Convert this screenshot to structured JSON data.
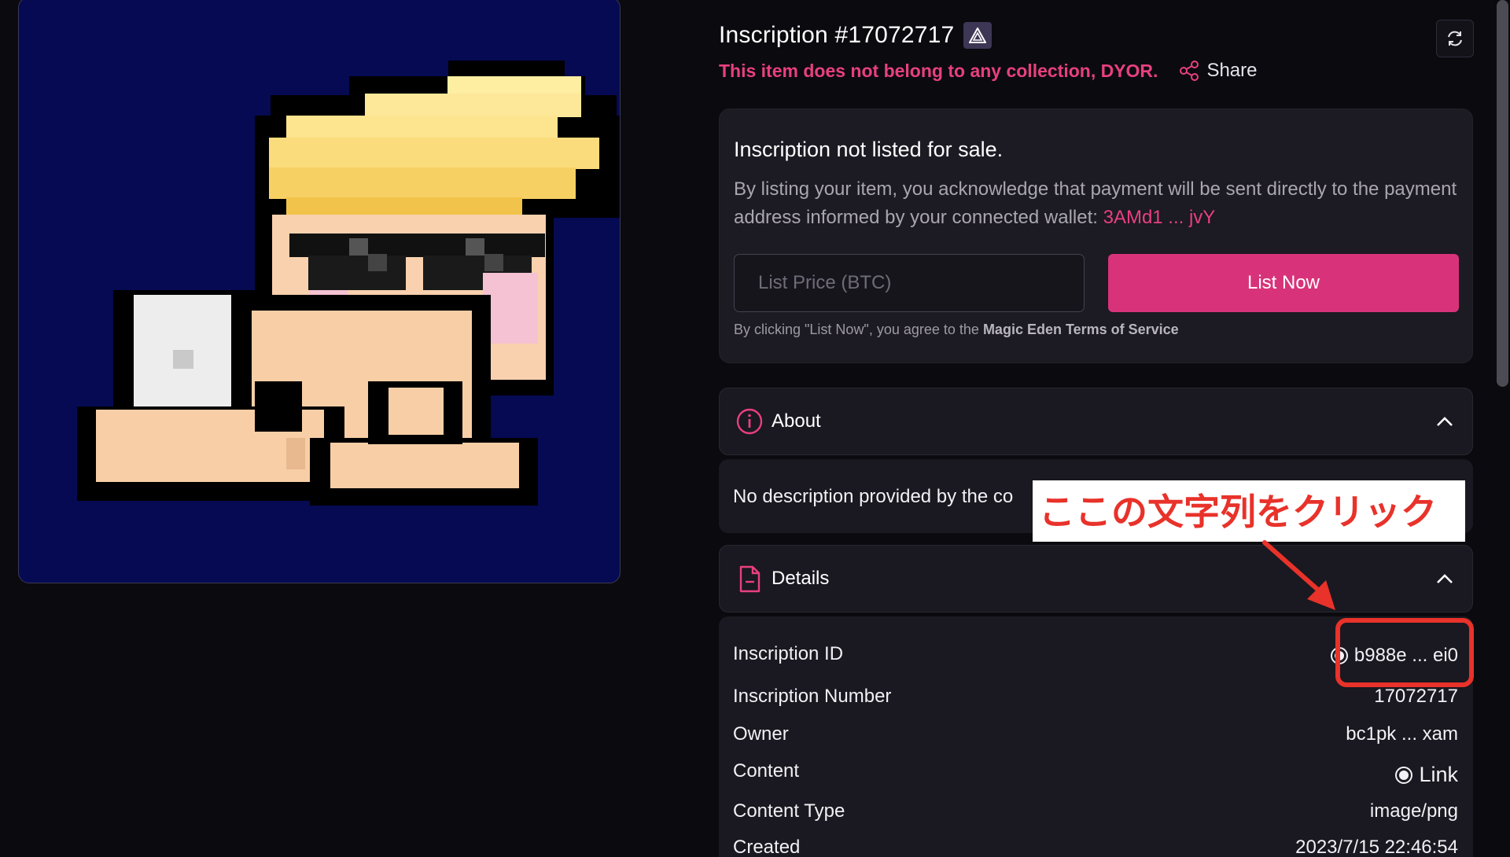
{
  "inscription": {
    "title": "Inscription #17072717",
    "warning": "This item does not belong to any collection, DYOR.",
    "share_label": "Share"
  },
  "listing": {
    "heading": "Inscription not listed for sale.",
    "description": "By listing your item, you acknowledge that payment will be sent directly to the payment address informed by your connected wallet: ",
    "wallet_address": "3AMd1 ... jvY",
    "price_placeholder": "List Price (BTC)",
    "list_button": "List Now",
    "terms_prefix": "By clicking \"List Now\", you agree to the ",
    "terms_link": "Magic Eden Terms of Service"
  },
  "about": {
    "title": "About",
    "body": "No description provided by the co"
  },
  "details": {
    "title": "Details",
    "rows": [
      {
        "key": "Inscription ID",
        "value": "b988e ... ei0"
      },
      {
        "key": "Inscription Number",
        "value": "17072717"
      },
      {
        "key": "Owner",
        "value": "bc1pk ... xam"
      },
      {
        "key": "Content",
        "value": "Link"
      },
      {
        "key": "Content Type",
        "value": "image/png"
      },
      {
        "key": "Created",
        "value": "2023/7/15 22:46:54"
      }
    ]
  },
  "annotation": {
    "text": "ここの文字列をクリック"
  },
  "colors": {
    "accent": "#d8337a",
    "warning": "#e8407f",
    "annotation": "#e8322a",
    "art_background": "#060a52"
  }
}
